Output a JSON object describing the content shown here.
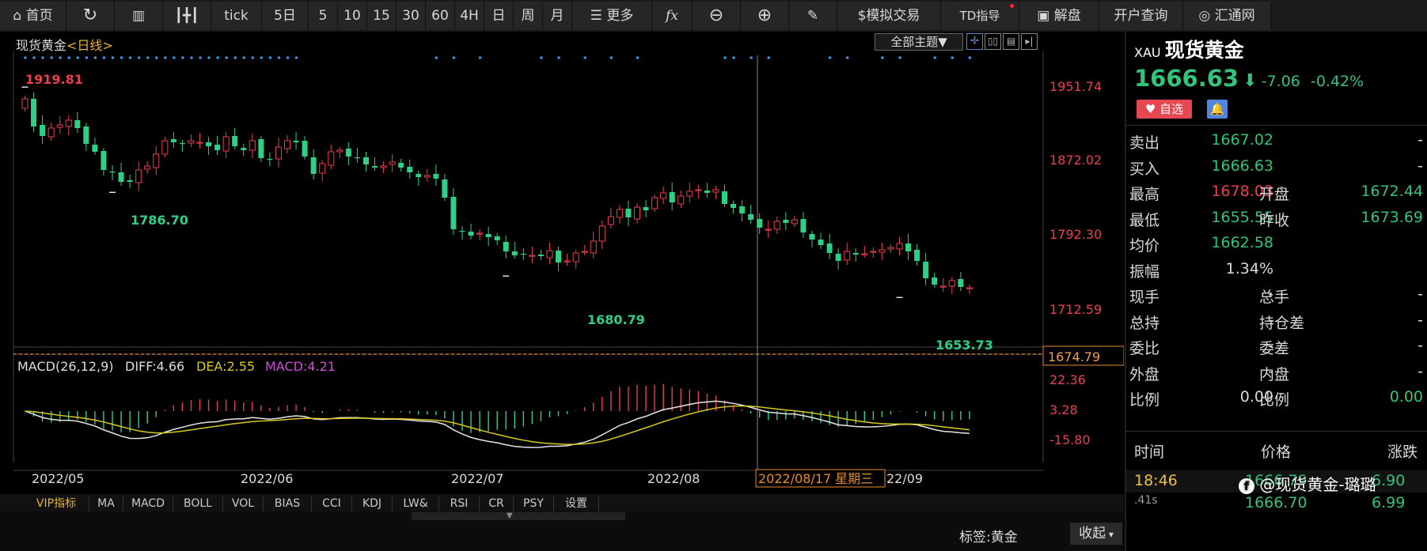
{
  "toolbar": {
    "home": "首页",
    "tick": "tick",
    "periods": [
      "5日",
      "5",
      "10",
      "15",
      "30",
      "60",
      "4H",
      "日",
      "周",
      "月"
    ],
    "more": "更多",
    "fx": "fx",
    "sim_trade": "$模拟交易",
    "td": "TD指导",
    "unlock": "解盘",
    "account": "开户查询",
    "brand": "汇通网"
  },
  "chart": {
    "title": "现货黄金",
    "period_label": "<日线>",
    "theme_button": "全部主题▼",
    "price_axis": [
      "1951.74",
      "1872.02",
      "1792.30",
      "1712.59"
    ],
    "current_price_tag": "1674.79",
    "annotations": {
      "high": "1919.81",
      "low1": "1786.70",
      "low2": "1680.79",
      "low3": "1653.73"
    },
    "macd_label": "MACD(26,12,9)",
    "diff_label": "DIFF:4.66",
    "dea_label": "DEA:2.55",
    "macd_value_label": "MACD:4.21",
    "macd_axis": [
      "22.36",
      "3.28",
      "-15.80"
    ],
    "date_axis": [
      "2022/05",
      "2022/06",
      "2022/07",
      "2022/08",
      "22/09"
    ],
    "crosshair_date": "2022/08/17 星期三",
    "colors": {
      "up": "#e8404e",
      "down": "#2fcf86",
      "diff": "#e6e6e6",
      "dea": "#d8c820",
      "macd": "#d24dd8"
    }
  },
  "chart_data": {
    "type": "candlestick",
    "title": "现货黄金<日线>",
    "ylim": [
      1640,
      1960
    ],
    "close": [
      1905,
      1870,
      1858,
      1868,
      1872,
      1878,
      1868,
      1848,
      1838,
      1815,
      1812,
      1800,
      1800,
      1815,
      1820,
      1835,
      1852,
      1850,
      1848,
      1852,
      1850,
      1845,
      1840,
      1857,
      1845,
      1840,
      1852,
      1830,
      1828,
      1844,
      1852,
      1850,
      1832,
      1810,
      1823,
      1838,
      1840,
      1832,
      1830,
      1822,
      1818,
      1820,
      1825,
      1818,
      1812,
      1806,
      1808,
      1804,
      1780,
      1740,
      1737,
      1732,
      1735,
      1730,
      1726,
      1712,
      1707,
      1708,
      1707,
      1706,
      1713,
      1698,
      1700,
      1710,
      1712,
      1725,
      1744,
      1756,
      1765,
      1755,
      1768,
      1764,
      1780,
      1786,
      1774,
      1782,
      1788,
      1790,
      1786,
      1790,
      1772,
      1767,
      1760,
      1752,
      1742,
      1740,
      1750,
      1748,
      1752,
      1736,
      1727,
      1720,
      1710,
      1700,
      1712,
      1708,
      1709,
      1712,
      1714,
      1717,
      1722,
      1712,
      1700,
      1678,
      1670,
      1668,
      1675,
      1667,
      1666
    ],
    "high_marker": 1919.81,
    "low_markers": [
      1786.7,
      1680.79,
      1653.73
    ],
    "current": 1674.79
  },
  "tabs": [
    "VIP指标",
    "MA",
    "MACD",
    "BOLL",
    "VOL",
    "BIAS",
    "CCI",
    "KDJ",
    "LW&",
    "RSI",
    "CR",
    "PSY",
    "设置"
  ],
  "status": {
    "tag": "标签:黄金",
    "collapse": "收起"
  },
  "quote": {
    "code": "XAU",
    "name": "现货黄金",
    "price": "1666.63",
    "arrow": "⬇",
    "change": "-7.06",
    "change_pct": "-0.42%",
    "watch_btn": "自选",
    "rows": [
      {
        "l1": "卖出",
        "v1": "1667.02",
        "l2": "",
        "v2": "-"
      },
      {
        "l1": "买入",
        "v1": "1666.63",
        "l2": "",
        "v2": "-"
      },
      {
        "l1": "最高",
        "v1": "1678.03",
        "l2": "开盘",
        "v2": "1672.44"
      },
      {
        "l1": "最低",
        "v1": "1655.55",
        "l2": "昨收",
        "v2": "1673.69"
      },
      {
        "l1": "均价",
        "v1": "1662.58",
        "l2": "",
        "v2": ""
      },
      {
        "l1": "振幅",
        "v1": "1.34%",
        "l2": "",
        "v2": ""
      },
      {
        "l1": "现手",
        "v1": "-",
        "l2": "总手",
        "v2": "-"
      },
      {
        "l1": "总持",
        "v1": "-",
        "l2": "持仓差",
        "v2": "-"
      },
      {
        "l1": "委比",
        "v1": "-",
        "l2": "委差",
        "v2": "-"
      },
      {
        "l1": "外盘",
        "v1": "-",
        "l2": "内盘",
        "v2": "-"
      },
      {
        "l1": "比例",
        "v1": "0.00",
        "l2": "比例",
        "v2": "0.00"
      }
    ],
    "trades_header": [
      "时间",
      "价格",
      "涨跌"
    ],
    "trades": [
      {
        "time": "18:46",
        "price": "1666.79",
        "chg": "6.90"
      },
      {
        "time": ".41s",
        "price": "1666.70",
        "chg": "6.99"
      }
    ],
    "watermark": "@现货黄金-璐璐"
  }
}
